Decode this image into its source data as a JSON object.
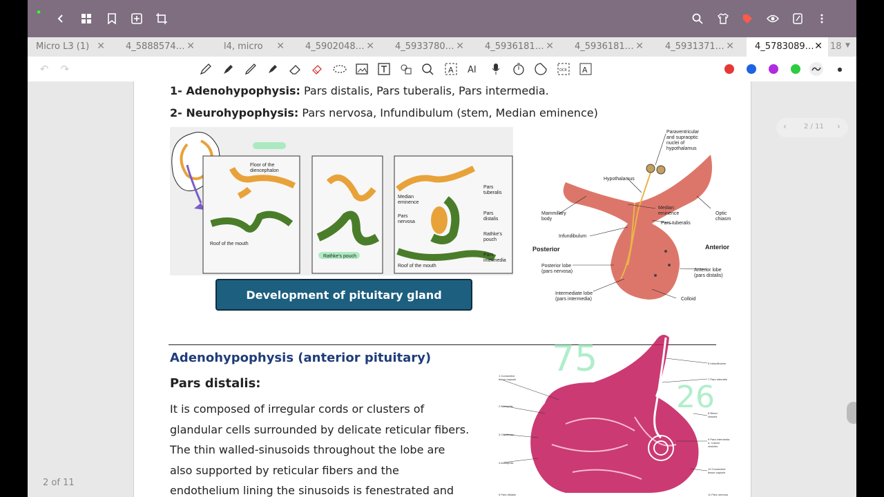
{
  "tabs": [
    {
      "label": "Micro L3 (1)"
    },
    {
      "label": "4_5888574…"
    },
    {
      "label": "l4, micro"
    },
    {
      "label": "4_5902048…"
    },
    {
      "label": "4_5933780…"
    },
    {
      "label": "4_5936181…"
    },
    {
      "label": "4_5936181…"
    },
    {
      "label": "4_5931371…"
    },
    {
      "label": "4_5783089…"
    }
  ],
  "tab_count": "18",
  "tab_close": "✕",
  "page_nav": {
    "label": "2 / 11"
  },
  "page_footer": "2 of 11",
  "colors": {
    "red": "#e53935",
    "blue": "#1e63e0",
    "purple": "#b02ce0",
    "green": "#2ecc40"
  },
  "content": {
    "line1_bold": "1- Adenohypophysis:",
    "line1_rest": " Pars distalis, Pars tuberalis, Pars intermedia.",
    "line2_bold": "2- Neurohypophysis:",
    "line2_rest": " Pars nervosa, Infundibulum (stem, Median eminence)",
    "dev_button": "Development of pituitary gland",
    "section_heading": "Adenohypophysis (anterior pituitary)",
    "subheading": "Pars distalis:",
    "paragraph": [
      "It is composed of irregular cords or clusters of",
      "glandular cells surrounded by delicate reticular fibers.",
      "The thin walled-sinusoids throughout the lobe are",
      "also supported by reticular fibers and the",
      "endothelium lining the sinusoids is fenestrated and"
    ],
    "dev_labels": {
      "floor": "Floor of the\ndiencephalon",
      "roof1": "Roof of the mouth",
      "rathke": "Rathke's pouch",
      "median": "Median\neminence",
      "nervosa": "Pars\nnervosa",
      "tuberalis": "Pars\ntuberalis",
      "distalis": "Pars\ndistalis",
      "rathke2": "Rathke's\npouch",
      "intermedia": "Pars\nintermedia",
      "roof2": "Roof of the mouth"
    },
    "gland_labels": {
      "para": "Paraventricular\nand supraoptic\nnuclei of\nhypothalamus",
      "hypo": "Hypothalamus",
      "mamm": "Mammillary\nbody",
      "median": "Median\neminence",
      "optic": "Optic\nchiasm",
      "tub": "Pars tuberalis",
      "infund": "Infundibulum",
      "post": "Posterior",
      "ant": "Anterior",
      "postlobe": "Posterior lobe\n(pars nervosa)",
      "antlobe": "Anterior lobe\n(pars distalis)",
      "inter": "Intermediate lobe\n(pars intermedia)",
      "colloid": "Colloid"
    },
    "histo_labels": {
      "l1": "1 Connective\ntissue capsule",
      "l2": "2 Basophils",
      "l3": "3 Capillaries",
      "l4": "4 Acidophils",
      "l5": "5 Pars distalis",
      "r5": "5 Infundibulum",
      "r7": "7 Pars tuberalis",
      "r8": "8 Blood\nvessels",
      "r9": "9 Pars intermedia\na. Colloid\nvesicles",
      "r10": "10 Connective\ntissue capsule",
      "r11": "11 Pars nervosa"
    },
    "handwritten": {
      "a": "75",
      "b": "26"
    }
  }
}
